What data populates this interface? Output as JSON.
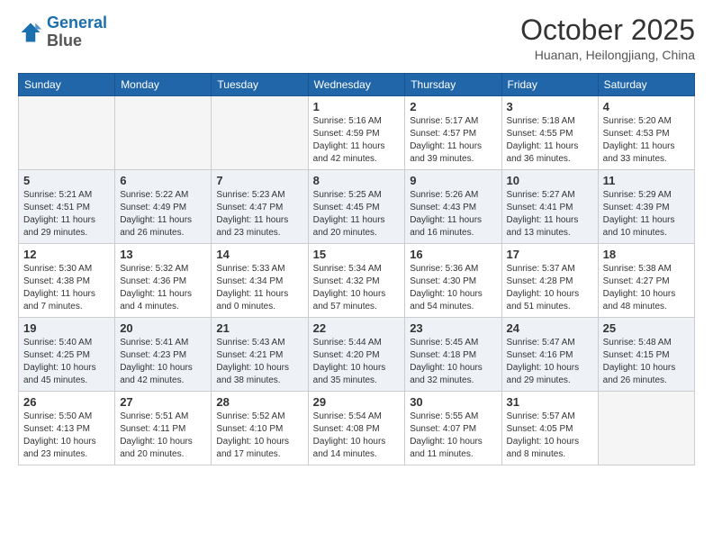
{
  "logo": {
    "line1": "General",
    "line2": "Blue"
  },
  "header": {
    "month": "October 2025",
    "location": "Huanan, Heilongjiang, China"
  },
  "weekdays": [
    "Sunday",
    "Monday",
    "Tuesday",
    "Wednesday",
    "Thursday",
    "Friday",
    "Saturday"
  ],
  "weeks": [
    [
      {
        "day": "",
        "info": ""
      },
      {
        "day": "",
        "info": ""
      },
      {
        "day": "",
        "info": ""
      },
      {
        "day": "1",
        "info": "Sunrise: 5:16 AM\nSunset: 4:59 PM\nDaylight: 11 hours\nand 42 minutes."
      },
      {
        "day": "2",
        "info": "Sunrise: 5:17 AM\nSunset: 4:57 PM\nDaylight: 11 hours\nand 39 minutes."
      },
      {
        "day": "3",
        "info": "Sunrise: 5:18 AM\nSunset: 4:55 PM\nDaylight: 11 hours\nand 36 minutes."
      },
      {
        "day": "4",
        "info": "Sunrise: 5:20 AM\nSunset: 4:53 PM\nDaylight: 11 hours\nand 33 minutes."
      }
    ],
    [
      {
        "day": "5",
        "info": "Sunrise: 5:21 AM\nSunset: 4:51 PM\nDaylight: 11 hours\nand 29 minutes."
      },
      {
        "day": "6",
        "info": "Sunrise: 5:22 AM\nSunset: 4:49 PM\nDaylight: 11 hours\nand 26 minutes."
      },
      {
        "day": "7",
        "info": "Sunrise: 5:23 AM\nSunset: 4:47 PM\nDaylight: 11 hours\nand 23 minutes."
      },
      {
        "day": "8",
        "info": "Sunrise: 5:25 AM\nSunset: 4:45 PM\nDaylight: 11 hours\nand 20 minutes."
      },
      {
        "day": "9",
        "info": "Sunrise: 5:26 AM\nSunset: 4:43 PM\nDaylight: 11 hours\nand 16 minutes."
      },
      {
        "day": "10",
        "info": "Sunrise: 5:27 AM\nSunset: 4:41 PM\nDaylight: 11 hours\nand 13 minutes."
      },
      {
        "day": "11",
        "info": "Sunrise: 5:29 AM\nSunset: 4:39 PM\nDaylight: 11 hours\nand 10 minutes."
      }
    ],
    [
      {
        "day": "12",
        "info": "Sunrise: 5:30 AM\nSunset: 4:38 PM\nDaylight: 11 hours\nand 7 minutes."
      },
      {
        "day": "13",
        "info": "Sunrise: 5:32 AM\nSunset: 4:36 PM\nDaylight: 11 hours\nand 4 minutes."
      },
      {
        "day": "14",
        "info": "Sunrise: 5:33 AM\nSunset: 4:34 PM\nDaylight: 11 hours\nand 0 minutes."
      },
      {
        "day": "15",
        "info": "Sunrise: 5:34 AM\nSunset: 4:32 PM\nDaylight: 10 hours\nand 57 minutes."
      },
      {
        "day": "16",
        "info": "Sunrise: 5:36 AM\nSunset: 4:30 PM\nDaylight: 10 hours\nand 54 minutes."
      },
      {
        "day": "17",
        "info": "Sunrise: 5:37 AM\nSunset: 4:28 PM\nDaylight: 10 hours\nand 51 minutes."
      },
      {
        "day": "18",
        "info": "Sunrise: 5:38 AM\nSunset: 4:27 PM\nDaylight: 10 hours\nand 48 minutes."
      }
    ],
    [
      {
        "day": "19",
        "info": "Sunrise: 5:40 AM\nSunset: 4:25 PM\nDaylight: 10 hours\nand 45 minutes."
      },
      {
        "day": "20",
        "info": "Sunrise: 5:41 AM\nSunset: 4:23 PM\nDaylight: 10 hours\nand 42 minutes."
      },
      {
        "day": "21",
        "info": "Sunrise: 5:43 AM\nSunset: 4:21 PM\nDaylight: 10 hours\nand 38 minutes."
      },
      {
        "day": "22",
        "info": "Sunrise: 5:44 AM\nSunset: 4:20 PM\nDaylight: 10 hours\nand 35 minutes."
      },
      {
        "day": "23",
        "info": "Sunrise: 5:45 AM\nSunset: 4:18 PM\nDaylight: 10 hours\nand 32 minutes."
      },
      {
        "day": "24",
        "info": "Sunrise: 5:47 AM\nSunset: 4:16 PM\nDaylight: 10 hours\nand 29 minutes."
      },
      {
        "day": "25",
        "info": "Sunrise: 5:48 AM\nSunset: 4:15 PM\nDaylight: 10 hours\nand 26 minutes."
      }
    ],
    [
      {
        "day": "26",
        "info": "Sunrise: 5:50 AM\nSunset: 4:13 PM\nDaylight: 10 hours\nand 23 minutes."
      },
      {
        "day": "27",
        "info": "Sunrise: 5:51 AM\nSunset: 4:11 PM\nDaylight: 10 hours\nand 20 minutes."
      },
      {
        "day": "28",
        "info": "Sunrise: 5:52 AM\nSunset: 4:10 PM\nDaylight: 10 hours\nand 17 minutes."
      },
      {
        "day": "29",
        "info": "Sunrise: 5:54 AM\nSunset: 4:08 PM\nDaylight: 10 hours\nand 14 minutes."
      },
      {
        "day": "30",
        "info": "Sunrise: 5:55 AM\nSunset: 4:07 PM\nDaylight: 10 hours\nand 11 minutes."
      },
      {
        "day": "31",
        "info": "Sunrise: 5:57 AM\nSunset: 4:05 PM\nDaylight: 10 hours\nand 8 minutes."
      },
      {
        "day": "",
        "info": ""
      }
    ]
  ]
}
